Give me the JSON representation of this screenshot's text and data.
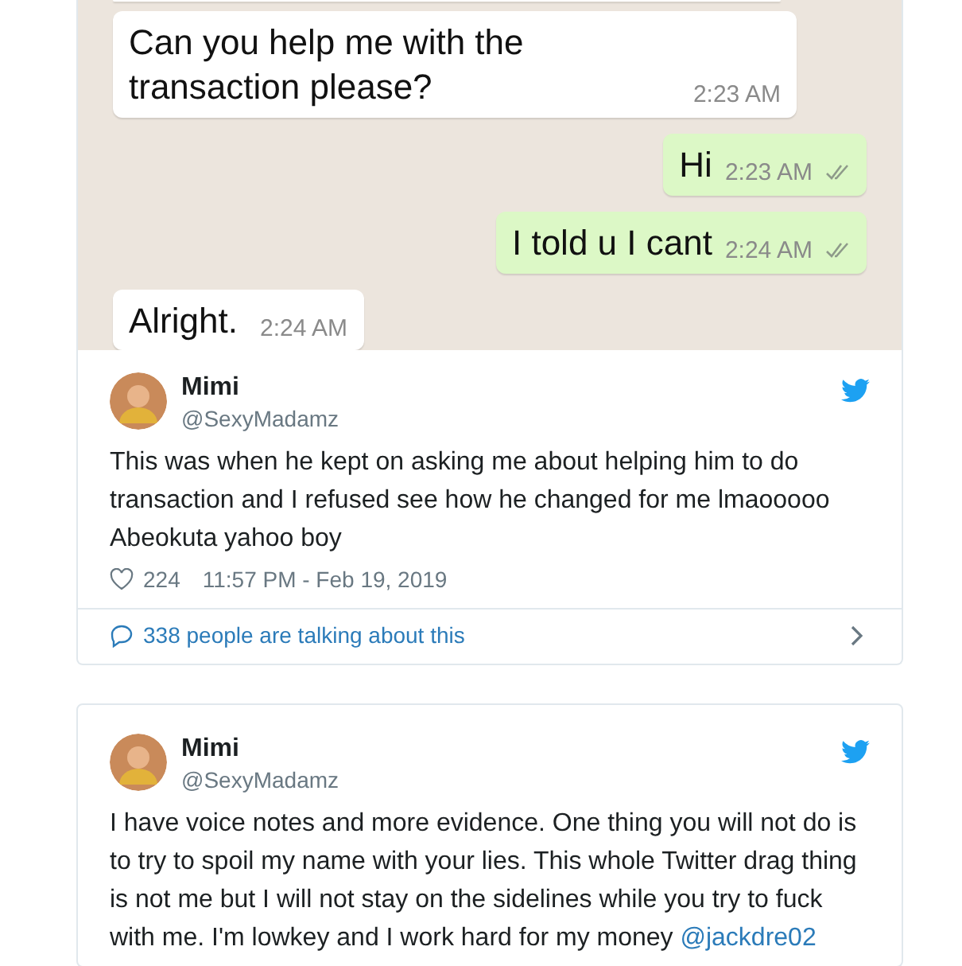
{
  "chat": {
    "messages": [
      {
        "kind": "received",
        "text": "Can you help me with the transaction please?",
        "time": "2:23 AM"
      },
      {
        "kind": "sent",
        "text": "Hi",
        "time": "2:23 AM"
      },
      {
        "kind": "sent",
        "text": "I told u I cant",
        "time": "2:24 AM"
      },
      {
        "kind": "received",
        "text": "Alright.",
        "time": "2:24 AM"
      }
    ]
  },
  "tweets": [
    {
      "name": "Mimi",
      "handle": "@SexyMadamz",
      "text": "This was when he kept on asking me about helping him to do transaction and I refused see how he changed for me lmaooooo Abeokuta yahoo boy",
      "likes": "224",
      "timestamp": "11:57 PM - Feb 19, 2019",
      "conversation": "338 people are talking about this"
    },
    {
      "name": "Mimi",
      "handle": "@SexyMadamz",
      "text": "I have voice notes and more evidence. One thing you will not do is to try to spoil my name with your lies. This whole Twitter drag thing is not me but I will not stay on the sidelines while you try to fuck with me. I'm lowkey and I work hard for my money",
      "mention": "@jackdre02"
    }
  ]
}
